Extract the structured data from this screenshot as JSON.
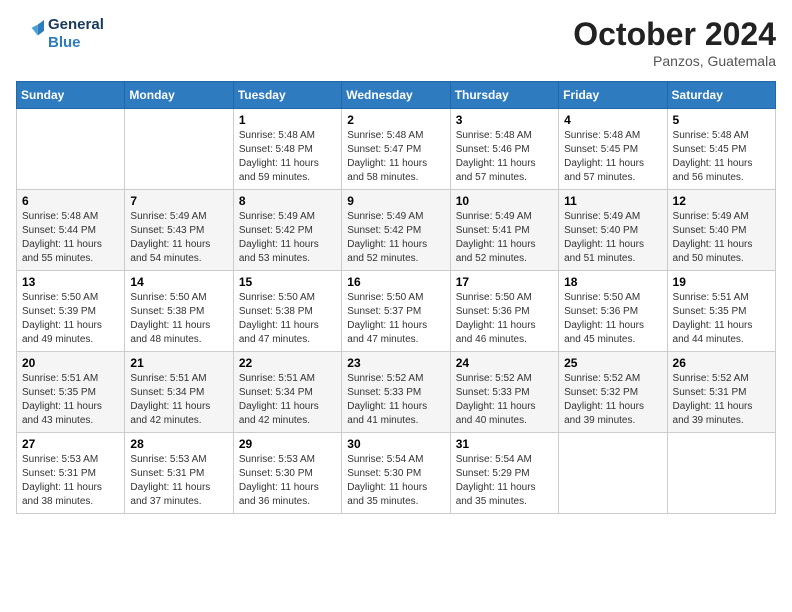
{
  "logo": {
    "line1": "General",
    "line2": "Blue"
  },
  "title": "October 2024",
  "location": "Panzos, Guatemala",
  "weekdays": [
    "Sunday",
    "Monday",
    "Tuesday",
    "Wednesday",
    "Thursday",
    "Friday",
    "Saturday"
  ],
  "weeks": [
    [
      {
        "day": "",
        "sunrise": "",
        "sunset": "",
        "daylight": ""
      },
      {
        "day": "",
        "sunrise": "",
        "sunset": "",
        "daylight": ""
      },
      {
        "day": "1",
        "sunrise": "Sunrise: 5:48 AM",
        "sunset": "Sunset: 5:48 PM",
        "daylight": "Daylight: 11 hours and 59 minutes."
      },
      {
        "day": "2",
        "sunrise": "Sunrise: 5:48 AM",
        "sunset": "Sunset: 5:47 PM",
        "daylight": "Daylight: 11 hours and 58 minutes."
      },
      {
        "day": "3",
        "sunrise": "Sunrise: 5:48 AM",
        "sunset": "Sunset: 5:46 PM",
        "daylight": "Daylight: 11 hours and 57 minutes."
      },
      {
        "day": "4",
        "sunrise": "Sunrise: 5:48 AM",
        "sunset": "Sunset: 5:45 PM",
        "daylight": "Daylight: 11 hours and 57 minutes."
      },
      {
        "day": "5",
        "sunrise": "Sunrise: 5:48 AM",
        "sunset": "Sunset: 5:45 PM",
        "daylight": "Daylight: 11 hours and 56 minutes."
      }
    ],
    [
      {
        "day": "6",
        "sunrise": "Sunrise: 5:48 AM",
        "sunset": "Sunset: 5:44 PM",
        "daylight": "Daylight: 11 hours and 55 minutes."
      },
      {
        "day": "7",
        "sunrise": "Sunrise: 5:49 AM",
        "sunset": "Sunset: 5:43 PM",
        "daylight": "Daylight: 11 hours and 54 minutes."
      },
      {
        "day": "8",
        "sunrise": "Sunrise: 5:49 AM",
        "sunset": "Sunset: 5:42 PM",
        "daylight": "Daylight: 11 hours and 53 minutes."
      },
      {
        "day": "9",
        "sunrise": "Sunrise: 5:49 AM",
        "sunset": "Sunset: 5:42 PM",
        "daylight": "Daylight: 11 hours and 52 minutes."
      },
      {
        "day": "10",
        "sunrise": "Sunrise: 5:49 AM",
        "sunset": "Sunset: 5:41 PM",
        "daylight": "Daylight: 11 hours and 52 minutes."
      },
      {
        "day": "11",
        "sunrise": "Sunrise: 5:49 AM",
        "sunset": "Sunset: 5:40 PM",
        "daylight": "Daylight: 11 hours and 51 minutes."
      },
      {
        "day": "12",
        "sunrise": "Sunrise: 5:49 AM",
        "sunset": "Sunset: 5:40 PM",
        "daylight": "Daylight: 11 hours and 50 minutes."
      }
    ],
    [
      {
        "day": "13",
        "sunrise": "Sunrise: 5:50 AM",
        "sunset": "Sunset: 5:39 PM",
        "daylight": "Daylight: 11 hours and 49 minutes."
      },
      {
        "day": "14",
        "sunrise": "Sunrise: 5:50 AM",
        "sunset": "Sunset: 5:38 PM",
        "daylight": "Daylight: 11 hours and 48 minutes."
      },
      {
        "day": "15",
        "sunrise": "Sunrise: 5:50 AM",
        "sunset": "Sunset: 5:38 PM",
        "daylight": "Daylight: 11 hours and 47 minutes."
      },
      {
        "day": "16",
        "sunrise": "Sunrise: 5:50 AM",
        "sunset": "Sunset: 5:37 PM",
        "daylight": "Daylight: 11 hours and 47 minutes."
      },
      {
        "day": "17",
        "sunrise": "Sunrise: 5:50 AM",
        "sunset": "Sunset: 5:36 PM",
        "daylight": "Daylight: 11 hours and 46 minutes."
      },
      {
        "day": "18",
        "sunrise": "Sunrise: 5:50 AM",
        "sunset": "Sunset: 5:36 PM",
        "daylight": "Daylight: 11 hours and 45 minutes."
      },
      {
        "day": "19",
        "sunrise": "Sunrise: 5:51 AM",
        "sunset": "Sunset: 5:35 PM",
        "daylight": "Daylight: 11 hours and 44 minutes."
      }
    ],
    [
      {
        "day": "20",
        "sunrise": "Sunrise: 5:51 AM",
        "sunset": "Sunset: 5:35 PM",
        "daylight": "Daylight: 11 hours and 43 minutes."
      },
      {
        "day": "21",
        "sunrise": "Sunrise: 5:51 AM",
        "sunset": "Sunset: 5:34 PM",
        "daylight": "Daylight: 11 hours and 42 minutes."
      },
      {
        "day": "22",
        "sunrise": "Sunrise: 5:51 AM",
        "sunset": "Sunset: 5:34 PM",
        "daylight": "Daylight: 11 hours and 42 minutes."
      },
      {
        "day": "23",
        "sunrise": "Sunrise: 5:52 AM",
        "sunset": "Sunset: 5:33 PM",
        "daylight": "Daylight: 11 hours and 41 minutes."
      },
      {
        "day": "24",
        "sunrise": "Sunrise: 5:52 AM",
        "sunset": "Sunset: 5:33 PM",
        "daylight": "Daylight: 11 hours and 40 minutes."
      },
      {
        "day": "25",
        "sunrise": "Sunrise: 5:52 AM",
        "sunset": "Sunset: 5:32 PM",
        "daylight": "Daylight: 11 hours and 39 minutes."
      },
      {
        "day": "26",
        "sunrise": "Sunrise: 5:52 AM",
        "sunset": "Sunset: 5:31 PM",
        "daylight": "Daylight: 11 hours and 39 minutes."
      }
    ],
    [
      {
        "day": "27",
        "sunrise": "Sunrise: 5:53 AM",
        "sunset": "Sunset: 5:31 PM",
        "daylight": "Daylight: 11 hours and 38 minutes."
      },
      {
        "day": "28",
        "sunrise": "Sunrise: 5:53 AM",
        "sunset": "Sunset: 5:31 PM",
        "daylight": "Daylight: 11 hours and 37 minutes."
      },
      {
        "day": "29",
        "sunrise": "Sunrise: 5:53 AM",
        "sunset": "Sunset: 5:30 PM",
        "daylight": "Daylight: 11 hours and 36 minutes."
      },
      {
        "day": "30",
        "sunrise": "Sunrise: 5:54 AM",
        "sunset": "Sunset: 5:30 PM",
        "daylight": "Daylight: 11 hours and 35 minutes."
      },
      {
        "day": "31",
        "sunrise": "Sunrise: 5:54 AM",
        "sunset": "Sunset: 5:29 PM",
        "daylight": "Daylight: 11 hours and 35 minutes."
      },
      {
        "day": "",
        "sunrise": "",
        "sunset": "",
        "daylight": ""
      },
      {
        "day": "",
        "sunrise": "",
        "sunset": "",
        "daylight": ""
      }
    ]
  ]
}
